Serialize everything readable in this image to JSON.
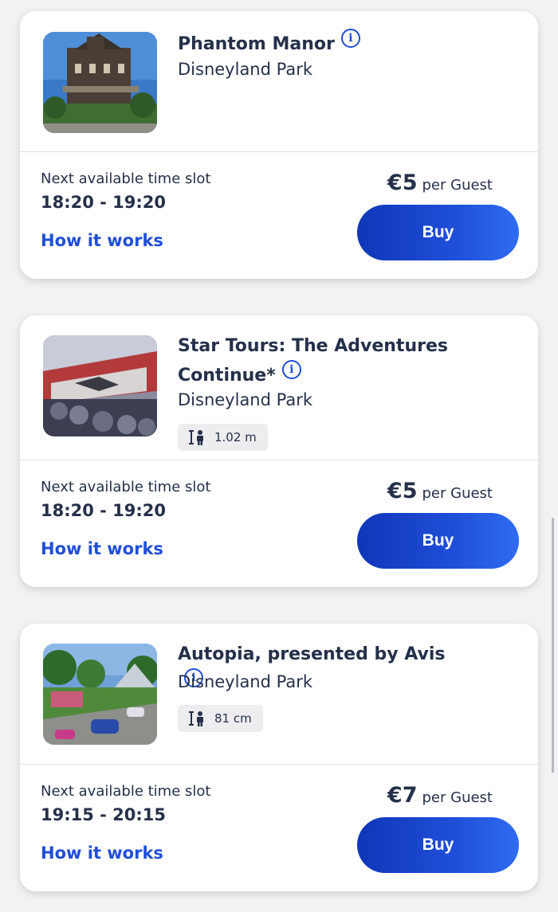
{
  "colors": {
    "accent": "#1f4ed8",
    "text": "#253049",
    "background": "#f2f2f4"
  },
  "cards": [
    {
      "title_line1": "Phantom Manor",
      "title_line2": "",
      "park": "Disneyland Park",
      "height": "",
      "slot_label": "Next available time slot",
      "slot_time": "18:20 - 19:20",
      "how_label": "How it works",
      "price": "€5",
      "price_unit": "per Guest",
      "buy_label": "Buy"
    },
    {
      "title_line1": "Star Tours: The Adventures",
      "title_line2": "Continue*",
      "park": "Disneyland Park",
      "height": "1.02 m",
      "slot_label": "Next available time slot",
      "slot_time": "18:20 - 19:20",
      "how_label": "How it works",
      "price": "€5",
      "price_unit": "per Guest",
      "buy_label": "Buy"
    },
    {
      "title_line1": "Autopia, presented by Avis",
      "title_line2": "",
      "park": "Disneyland Park",
      "height": "81 cm",
      "slot_label": "Next available time slot",
      "slot_time": "19:15 - 20:15",
      "how_label": "How it works",
      "price": "€7",
      "price_unit": "per Guest",
      "buy_label": "Buy"
    }
  ],
  "icons": {
    "info": "info-icon",
    "height": "height-requirement-icon"
  }
}
